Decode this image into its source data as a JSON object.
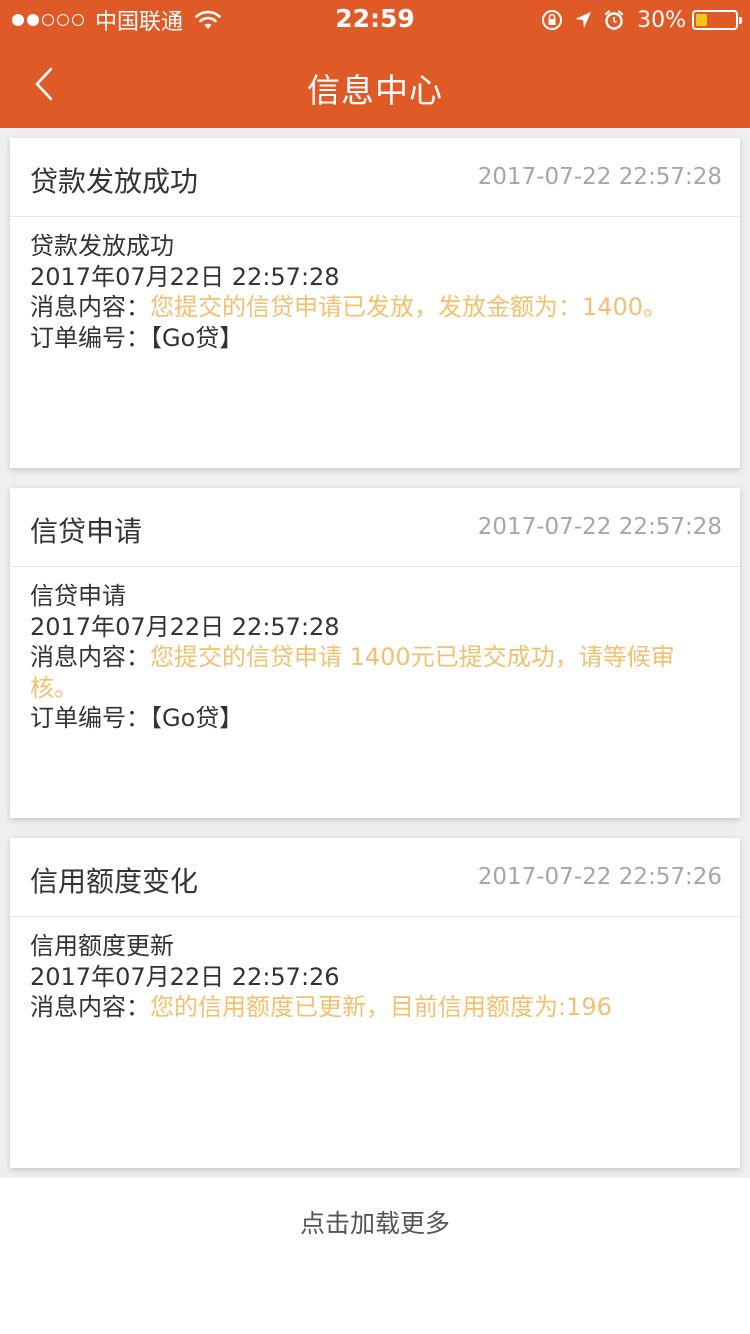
{
  "status_bar": {
    "carrier": "中国联通",
    "time": "22:59",
    "battery_percent": "30%",
    "battery_level": 0.3,
    "icons": [
      "signal-dots",
      "wifi-icon",
      "orientation-lock-icon",
      "location-arrow-icon",
      "alarm-icon",
      "battery-icon"
    ]
  },
  "nav": {
    "title": "信息中心",
    "back_icon": "chevron-left-icon"
  },
  "colors": {
    "header": "#e05a28",
    "highlight_text": "#f2c06e",
    "timestamp": "#a6a6a6"
  },
  "messages": [
    {
      "title": "贷款发放成功",
      "time": "2017-07-22 22:57:28",
      "body_title": "贷款发放成功",
      "body_date": "2017年07月22日 22:57:28",
      "content_label": "消息内容：",
      "content_text": "您提交的信贷申请已发放，发放金额为：1400。",
      "order_label": "订单编号：",
      "order_value": "【Go贷】"
    },
    {
      "title": "信贷申请",
      "time": "2017-07-22 22:57:28",
      "body_title": "信贷申请",
      "body_date": "2017年07月22日 22:57:28",
      "content_label": "消息内容：",
      "content_text": "您提交的信贷申请 1400元已提交成功，请等候审核。",
      "order_label": "订单编号：",
      "order_value": "【Go贷】"
    },
    {
      "title": "信用额度变化",
      "time": "2017-07-22 22:57:26",
      "body_title": "信用额度更新",
      "body_date": "2017年07月22日 22:57:26",
      "content_label": "消息内容：",
      "content_text": "您的信用额度已更新，目前信用额度为:196"
    }
  ],
  "load_more": "点击加载更多"
}
